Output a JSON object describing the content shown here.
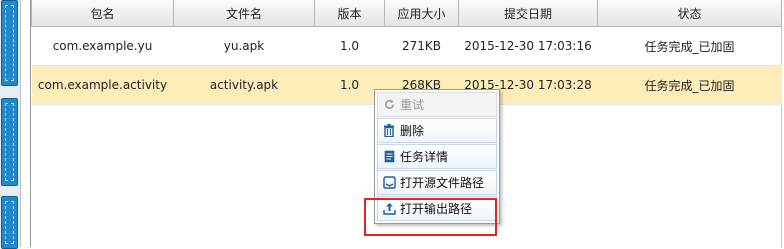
{
  "table": {
    "columns": [
      "包名",
      "文件名",
      "版本",
      "应用大小",
      "提交日期",
      "状态"
    ],
    "rows": [
      {
        "package": "com.example.yu",
        "file": "yu.apk",
        "version": "1.0",
        "size": "271KB",
        "date": "2015-12-30 17:03:16",
        "status": "任务完成_已加固"
      },
      {
        "package": "com.example.activity",
        "file": "activity.apk",
        "version": "1.0",
        "size": "268KB",
        "date": "2015-12-30 17:03:28",
        "status": "任务完成_已加固"
      }
    ],
    "selected_row": 1
  },
  "context_menu": {
    "items": [
      {
        "label": "重试",
        "icon": "retry-icon",
        "enabled": false
      },
      {
        "label": "删除",
        "icon": "trash-icon",
        "enabled": true
      },
      {
        "label": "任务详情",
        "icon": "document-icon",
        "enabled": true
      },
      {
        "label": "打开源文件路径",
        "icon": "folder-open-icon",
        "enabled": true
      },
      {
        "label": "打开输出路径",
        "icon": "upload-icon",
        "enabled": true
      }
    ],
    "highlighted_item": 4
  },
  "colors": {
    "selected_row": "#fcedb8",
    "highlight_box": "#e32323",
    "sidebar_tile": "#2189c9",
    "icon": "#1f5f9f"
  }
}
